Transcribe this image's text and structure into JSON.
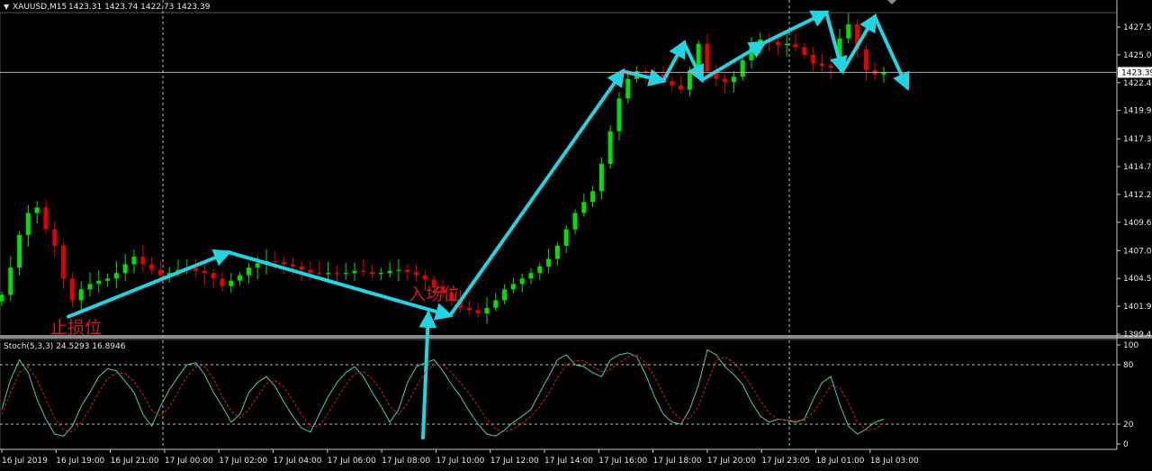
{
  "header": {
    "symbol": "XAUUSD,M15",
    "ohlc": "1423.31 1423.74 1422.73 1423.39"
  },
  "stoch_header": "Stoch(5,3,3) 24.5293 16.8946",
  "colors": {
    "background": "#000000",
    "bull": "#00e000",
    "bear": "#e00000",
    "arrow": "#22d3e0",
    "stoch_main": "#4ec9b0",
    "stoch_signal": "#d02020",
    "grid": "#c8c8c8",
    "annotation": "#d21e1e"
  },
  "annotations": {
    "stop_loss": "止损位",
    "entry": "入场位"
  },
  "chart_data": [
    {
      "type": "candlestick",
      "title": "XAUUSD,M15",
      "ylim": [
        1399.4,
        1429.5
      ],
      "y_ticks": [
        "1427.55",
        "1425.00",
        "1422.45",
        "1419.90",
        "1417.30",
        "1414.75",
        "1412.20",
        "1409.65",
        "1407.05",
        "1404.50",
        "1401.95",
        "1399.40"
      ],
      "current_price": "1423.39",
      "x_ticks": [
        "16 Jul 2019",
        "16 Jul 19:00",
        "16 Jul 21:00",
        "17 Jul 00:00",
        "17 Jul 02:00",
        "17 Jul 04:00",
        "17 Jul 06:00",
        "17 Jul 08:00",
        "17 Jul 10:00",
        "17 Jul 12:00",
        "17 Jul 14:00",
        "17 Jul 16:00",
        "17 Jul 18:00",
        "17 Jul 20:00",
        "17 Jul 23:05",
        "18 Jul 01:00",
        "18 Jul 03:00"
      ],
      "close_path": [
        1403.0,
        1405.5,
        1408.5,
        1410.5,
        1411.0,
        1409.0,
        1407.5,
        1404.5,
        1402.5,
        1403.5,
        1404.0,
        1404.3,
        1404.5,
        1405.0,
        1405.8,
        1406.5,
        1405.8,
        1405.3,
        1404.8,
        1405.0,
        1405.3,
        1405.5,
        1405.2,
        1405.0,
        1404.5,
        1403.8,
        1404.3,
        1404.8,
        1405.5,
        1405.9,
        1406.1,
        1406.0,
        1405.8,
        1405.6,
        1405.3,
        1405.0,
        1404.9,
        1405.0,
        1404.9,
        1405.0,
        1405.2,
        1405.1,
        1404.9,
        1405.0,
        1405.2,
        1405.3,
        1405.1,
        1404.8,
        1404.4,
        1403.8,
        1403.2,
        1402.5,
        1401.8,
        1401.6,
        1401.3,
        1401.8,
        1402.5,
        1403.5,
        1404.0,
        1404.5,
        1405.0,
        1405.6,
        1406.3,
        1407.5,
        1409.0,
        1410.5,
        1411.5,
        1412.5,
        1415.0,
        1418.0,
        1421.0,
        1422.8,
        1423.5,
        1423.4,
        1423.2,
        1422.6,
        1422.2,
        1421.8,
        1423.5,
        1426.0,
        1423.5,
        1422.8,
        1422.5,
        1423.0,
        1424.5,
        1426.0,
        1426.4,
        1426.2,
        1425.9,
        1426.0,
        1425.7,
        1425.0,
        1424.2,
        1424.0,
        1423.8,
        1426.5,
        1427.8,
        1425.5,
        1423.6,
        1423.2,
        1423.4
      ],
      "arrows": [
        [
          1401.0,
          1406.9
        ],
        [
          1406.9,
          1401.1
        ],
        [
          1401.1,
          1423.5
        ],
        [
          1423.5,
          1422.6
        ],
        [
          1422.6,
          1426.1
        ],
        [
          1426.1,
          1422.7
        ],
        [
          1422.7,
          1426.1
        ],
        [
          1426.1,
          1428.9
        ],
        [
          1428.9,
          1423.5
        ],
        [
          1423.5,
          1428.5
        ],
        [
          1428.5,
          1422.0
        ]
      ]
    },
    {
      "type": "line",
      "title": "Stoch(5,3,3) 24.5293 16.8946",
      "ylim": [
        0,
        100
      ],
      "y_ticks": [
        "100",
        "80",
        "20",
        "0"
      ],
      "levels": [
        80,
        20
      ],
      "series": [
        {
          "values": [
            35,
            65,
            85,
            72,
            45,
            25,
            10,
            8,
            18,
            38,
            52,
            68,
            76,
            74,
            63,
            52,
            30,
            18,
            38,
            55,
            68,
            80,
            82,
            70,
            52,
            38,
            22,
            30,
            52,
            62,
            68,
            58,
            42,
            28,
            16,
            12,
            30,
            48,
            62,
            72,
            78,
            68,
            52,
            38,
            22,
            35,
            62,
            78,
            82,
            85,
            74,
            60,
            48,
            33,
            20,
            10,
            8,
            14,
            22,
            28,
            35,
            52,
            68,
            85,
            90,
            80,
            78,
            72,
            68,
            85,
            90,
            92,
            88,
            70,
            48,
            30,
            22,
            20,
            35,
            60,
            95,
            90,
            78,
            70,
            60,
            42,
            28,
            22,
            25,
            24,
            22,
            25,
            45,
            62,
            68,
            40,
            18,
            10,
            15,
            22,
            25
          ]
        },
        {
          "values": [
            30,
            52,
            72,
            78,
            65,
            45,
            26,
            14,
            12,
            22,
            36,
            52,
            66,
            72,
            71,
            63,
            50,
            34,
            28,
            37,
            53,
            68,
            78,
            78,
            66,
            48,
            33,
            26,
            35,
            48,
            61,
            64,
            57,
            44,
            29,
            18,
            18,
            31,
            46,
            60,
            71,
            73,
            66,
            54,
            38,
            30,
            41,
            58,
            72,
            80,
            80,
            72,
            62,
            51,
            38,
            25,
            15,
            12,
            15,
            21,
            28,
            38,
            51,
            67,
            80,
            84,
            84,
            78,
            73,
            75,
            82,
            88,
            90,
            82,
            68,
            50,
            33,
            25,
            26,
            38,
            62,
            84,
            88,
            82,
            72,
            58,
            44,
            31,
            25,
            24,
            24,
            24,
            32,
            45,
            59,
            57,
            42,
            22,
            14,
            15,
            21
          ]
        }
      ]
    }
  ]
}
